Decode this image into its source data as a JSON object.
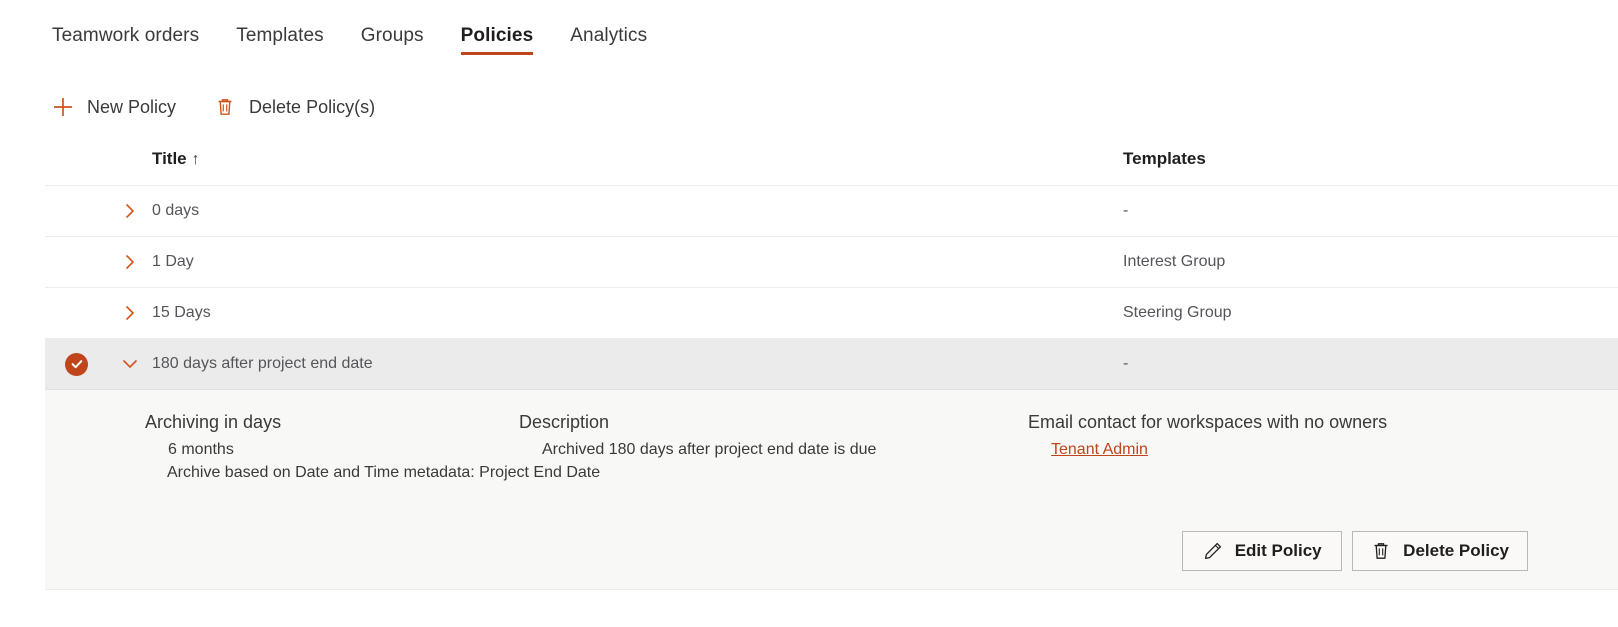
{
  "tabs": [
    {
      "label": "Teamwork orders",
      "active": false
    },
    {
      "label": "Templates",
      "active": false
    },
    {
      "label": "Groups",
      "active": false
    },
    {
      "label": "Policies",
      "active": true
    },
    {
      "label": "Analytics",
      "active": false
    }
  ],
  "commandbar": {
    "new_policy": {
      "label": "New Policy",
      "icon": "plus-icon"
    },
    "delete_policies": {
      "label": "Delete Policy(s)",
      "icon": "trash-icon"
    }
  },
  "table": {
    "columns": {
      "title": "Title",
      "title_sort": "↑",
      "templates": "Templates"
    },
    "rows": [
      {
        "title": "0 days",
        "templates": "-",
        "selected": false,
        "expanded": false
      },
      {
        "title": "1 Day",
        "templates": "Interest Group",
        "selected": false,
        "expanded": false
      },
      {
        "title": "15 Days",
        "templates": "Steering Group",
        "selected": false,
        "expanded": false
      },
      {
        "title": "180 days after project end date",
        "templates": "-",
        "selected": true,
        "expanded": true
      }
    ]
  },
  "detail": {
    "archiving": {
      "heading": "Archiving in days",
      "value": "6 months",
      "metadata": "Archive based on Date and Time metadata:  Project End Date"
    },
    "description": {
      "heading": "Description",
      "value": "Archived 180 days after project end date is due"
    },
    "email_contact": {
      "heading": "Email contact for workspaces with no owners",
      "link": "Tenant Admin"
    },
    "actions": {
      "edit": {
        "label": "Edit Policy",
        "icon": "pencil-icon"
      },
      "delete": {
        "label": "Delete Policy",
        "icon": "trash-icon"
      }
    }
  },
  "colors": {
    "accent": "#c0451a",
    "icon_orange": "#d0531c",
    "selected_row_bg": "#ebebeb",
    "detail_bg": "#f8f8f7"
  }
}
